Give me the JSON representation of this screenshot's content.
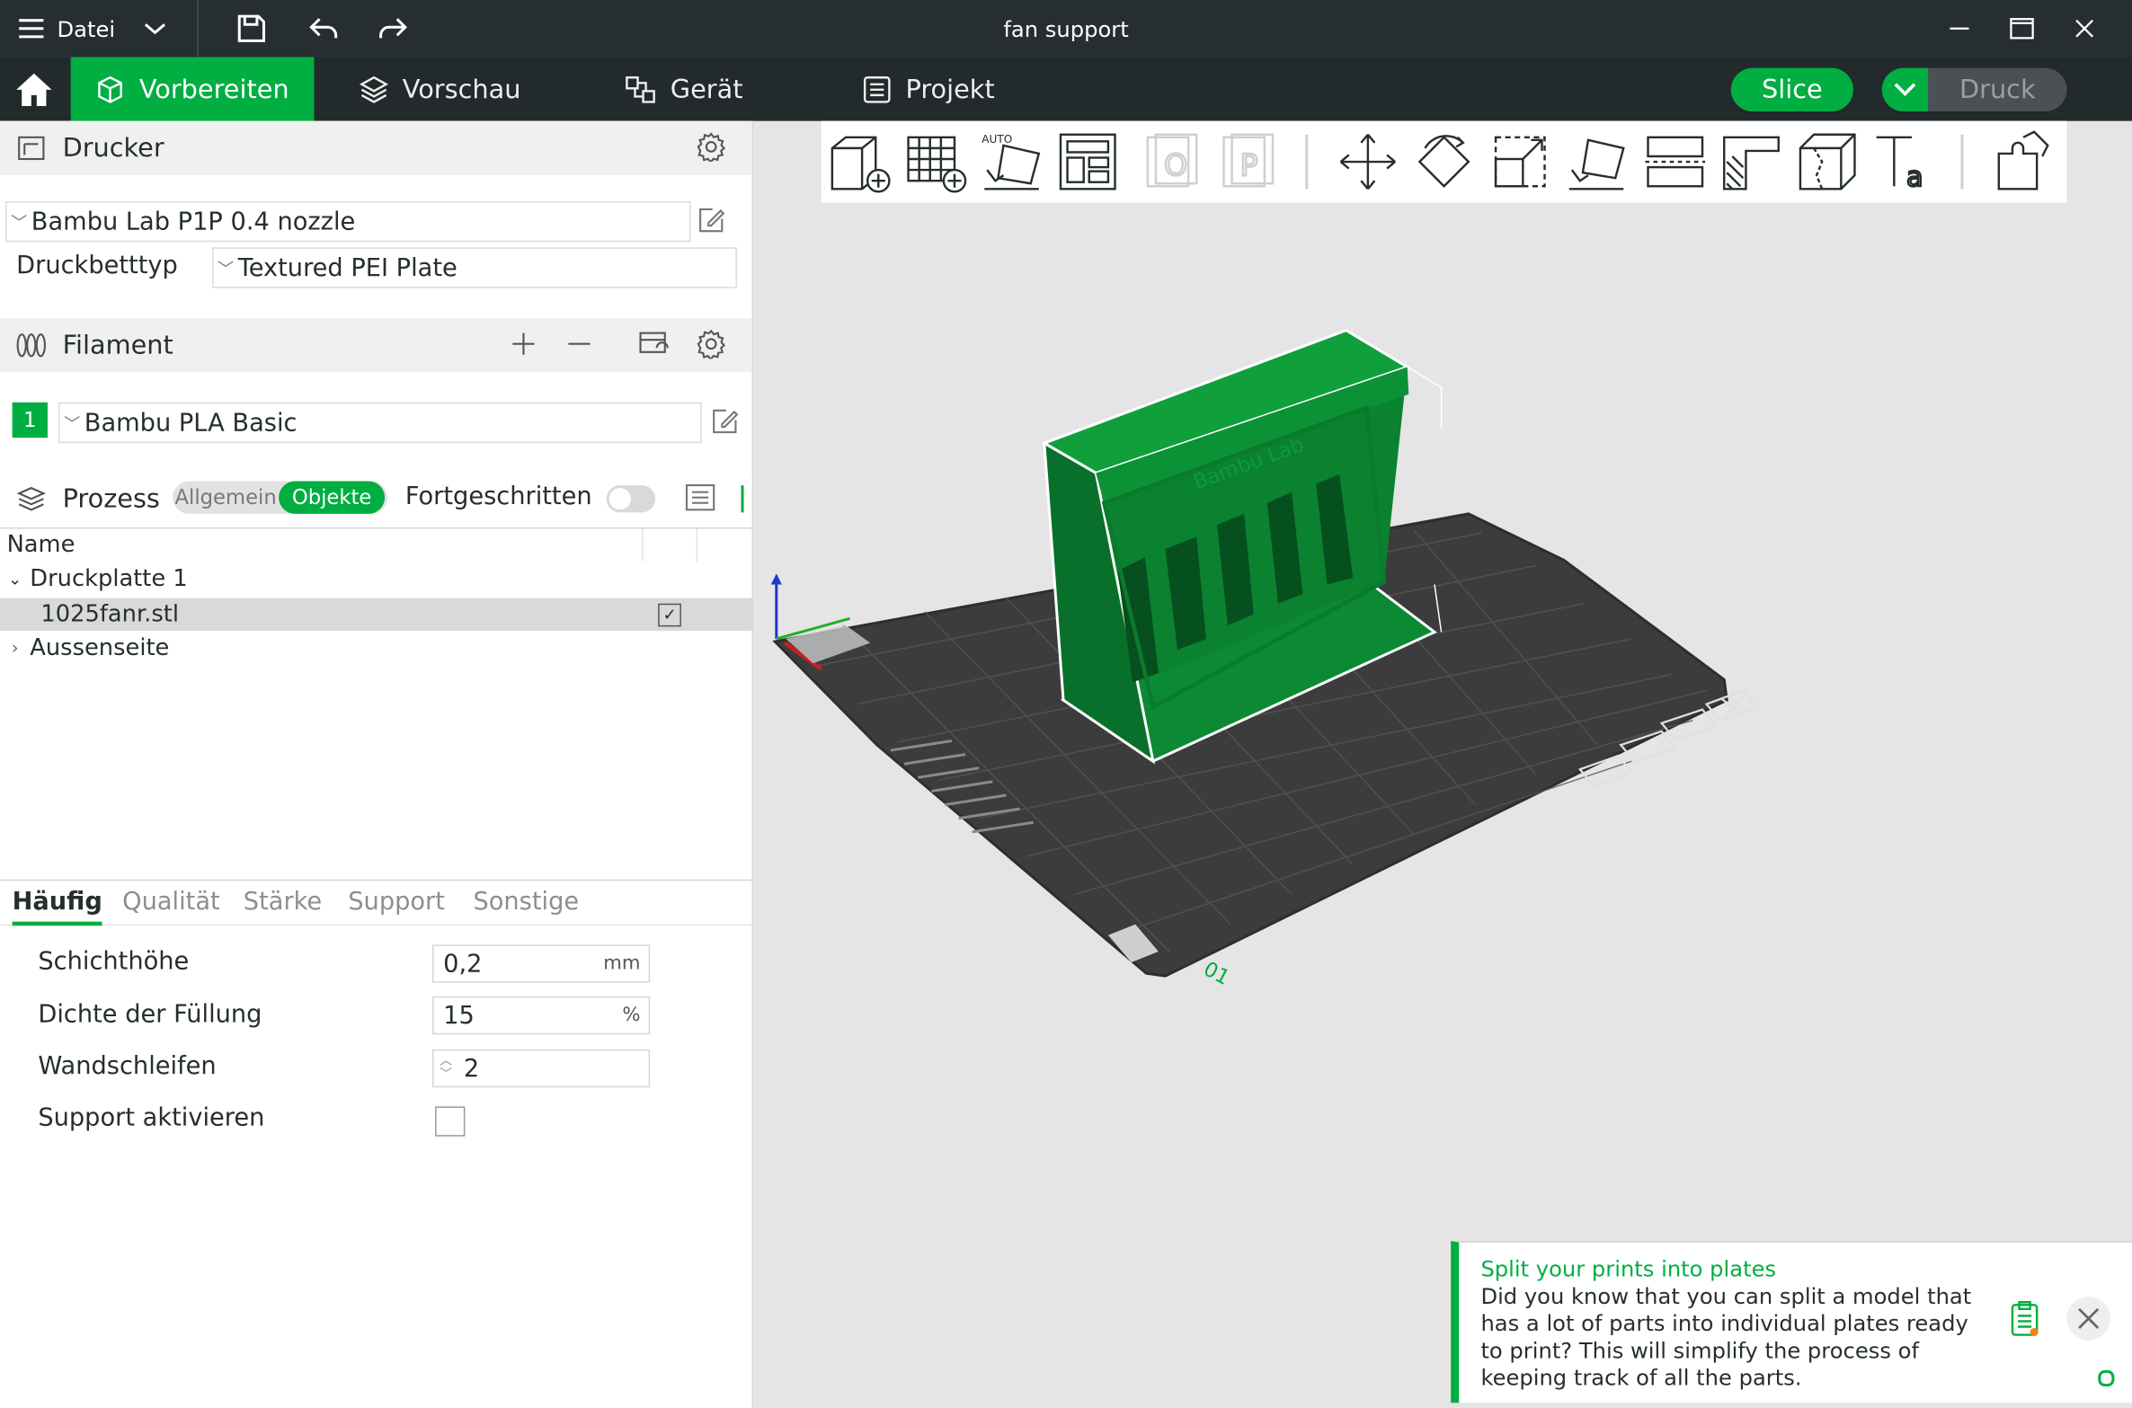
{
  "window": {
    "title": "fan support",
    "menu_label": "Datei"
  },
  "tabs": [
    {
      "label": "Vorbereiten",
      "active": true
    },
    {
      "label": "Vorschau"
    },
    {
      "label": "Gerät"
    },
    {
      "label": "Projekt"
    }
  ],
  "actions": {
    "slice": "Slice",
    "print": "Druck"
  },
  "printer": {
    "section_title": "Drucker",
    "selected": "Bambu Lab P1P 0.4 nozzle",
    "bed_type_label": "Druckbetttyp",
    "bed_type": "Textured PEI Plate"
  },
  "filament": {
    "section_title": "Filament",
    "slot_number": "1",
    "selected": "Bambu PLA Basic",
    "slot_color": "#00ae42"
  },
  "process": {
    "section_title": "Prozess",
    "mode_general": "Allgemein",
    "mode_objects": "Objekte",
    "advanced_label": "Fortgeschritten",
    "advanced_enabled": false
  },
  "object_list": {
    "header_name": "Name",
    "plate": "Druckplatte 1",
    "object": "1025fanr.stl",
    "object_checked": true,
    "part": "Aussenseite"
  },
  "param_tabs": [
    "Häufig",
    "Qualität",
    "Stärke",
    "Support",
    "Sonstige"
  ],
  "params": {
    "layer_height_label": "Schichthöhe",
    "layer_height": "0,2",
    "layer_height_unit": "mm",
    "infill_label": "Dichte der Füllung",
    "infill": "15",
    "infill_unit": "%",
    "walls_label": "Wandschleifen",
    "walls": "2",
    "support_label": "Support aktivieren",
    "support_enabled": false
  },
  "viewport": {
    "plate_label": "01",
    "model_emboss_text": "Bambu Lab",
    "model_color": "#0a8a33",
    "bed_color": "#3a3a3a",
    "background_color": "#e5e5e5",
    "toolbar_auto_label": "AUTO"
  },
  "notification": {
    "title": "Split your prints into plates",
    "body": "Did you know that you can split a model that has a lot of parts into individual plates ready to print? This will simplify the process of keeping track of all the parts."
  },
  "colors": {
    "accent": "#00ae42",
    "titlebar": "#262e30"
  }
}
